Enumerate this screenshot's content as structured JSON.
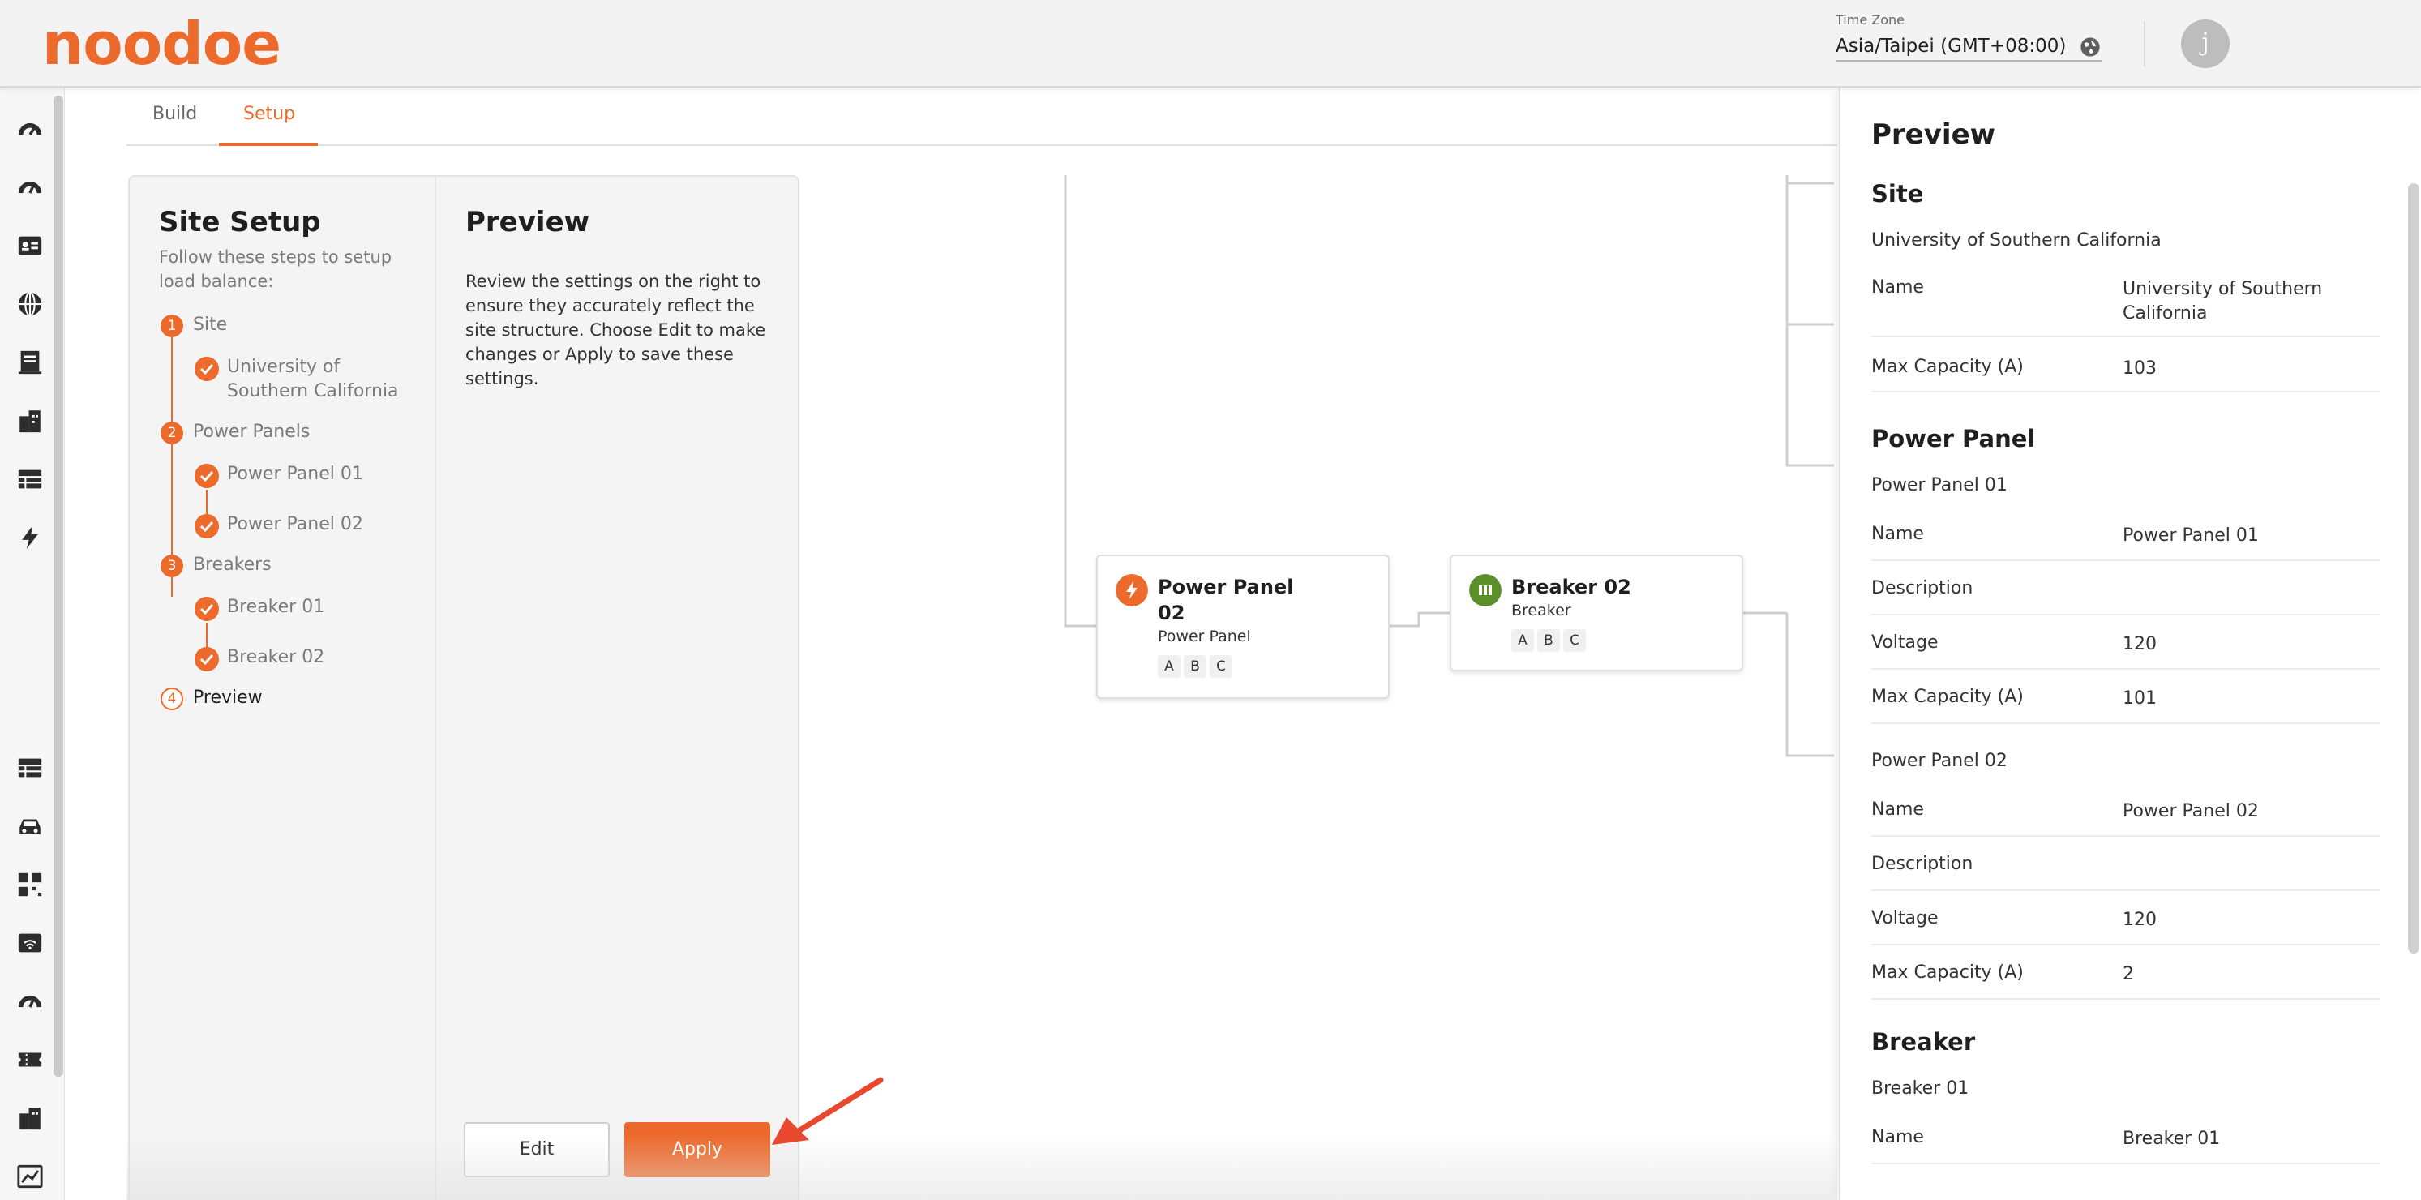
{
  "header": {
    "logo_text": "noodoe",
    "timezone_label": "Time Zone",
    "timezone_value": "Asia/Taipei (GMT+08:00)",
    "avatar_initial": "j"
  },
  "nav": {
    "icons": [
      "speedometer-icon",
      "speedometer-icon",
      "id-card-icon",
      "globe-icon",
      "building-icon",
      "city-icon",
      "table-icon",
      "lightning-icon",
      "table-icon",
      "car-icon",
      "qr-code-icon",
      "wifi-icon",
      "speedometer-icon",
      "ticket-icon",
      "city-icon",
      "chart-icon"
    ]
  },
  "tabs": [
    {
      "label": "Build",
      "active": false
    },
    {
      "label": "Setup",
      "active": true
    }
  ],
  "setup": {
    "title": "Site Setup",
    "subtitle": "Follow these steps to setup load balance:",
    "steps": [
      {
        "num": "1",
        "label": "Site",
        "items": [
          "University of Southern California"
        ]
      },
      {
        "num": "2",
        "label": "Power Panels",
        "items": [
          "Power Panel 01",
          "Power Panel 02"
        ]
      },
      {
        "num": "3",
        "label": "Breakers",
        "items": [
          "Breaker 01",
          "Breaker 02"
        ]
      },
      {
        "num": "4",
        "label": "Preview",
        "items": []
      }
    ],
    "preview_title": "Preview",
    "preview_desc": "Review the settings on the right to ensure they accurately reflect the site structure. Choose Edit to make changes or Apply to save these settings.",
    "edit_label": "Edit",
    "apply_label": "Apply"
  },
  "canvas": {
    "nodes": [
      {
        "title": "Power Panel 02",
        "type": "Power Panel",
        "phases": [
          "A",
          "B",
          "C"
        ],
        "icon": "lightning-icon",
        "color": "#ec6a2c"
      },
      {
        "title": "Breaker 02",
        "type": "Breaker",
        "phases": [
          "A",
          "B",
          "C"
        ],
        "icon": "breaker-icon",
        "color": "#5a8f2a"
      }
    ]
  },
  "drawer": {
    "title": "Preview",
    "site_heading": "Site",
    "site_name": "University of Southern California",
    "site_rows": [
      {
        "key": "Name",
        "value": "University of Southern California"
      },
      {
        "key": "Max Capacity (A)",
        "value": "103"
      }
    ],
    "panel_heading": "Power Panel",
    "panel1_name": "Power Panel 01",
    "panel1_rows": [
      {
        "key": "Name",
        "value": "Power Panel 01"
      },
      {
        "key": "Description",
        "value": ""
      },
      {
        "key": "Voltage",
        "value": "120"
      },
      {
        "key": "Max Capacity (A)",
        "value": "101"
      }
    ],
    "panel2_name": "Power Panel 02",
    "panel2_rows": [
      {
        "key": "Name",
        "value": "Power Panel 02"
      },
      {
        "key": "Description",
        "value": ""
      },
      {
        "key": "Voltage",
        "value": "120"
      },
      {
        "key": "Max Capacity (A)",
        "value": "2"
      }
    ],
    "breaker_heading": "Breaker",
    "breaker1_name": "Breaker 01",
    "breaker1_rows": [
      {
        "key": "Name",
        "value": "Breaker 01"
      }
    ]
  },
  "colors": {
    "accent": "#ec6a2c",
    "breaker_green": "#5a8f2a"
  }
}
